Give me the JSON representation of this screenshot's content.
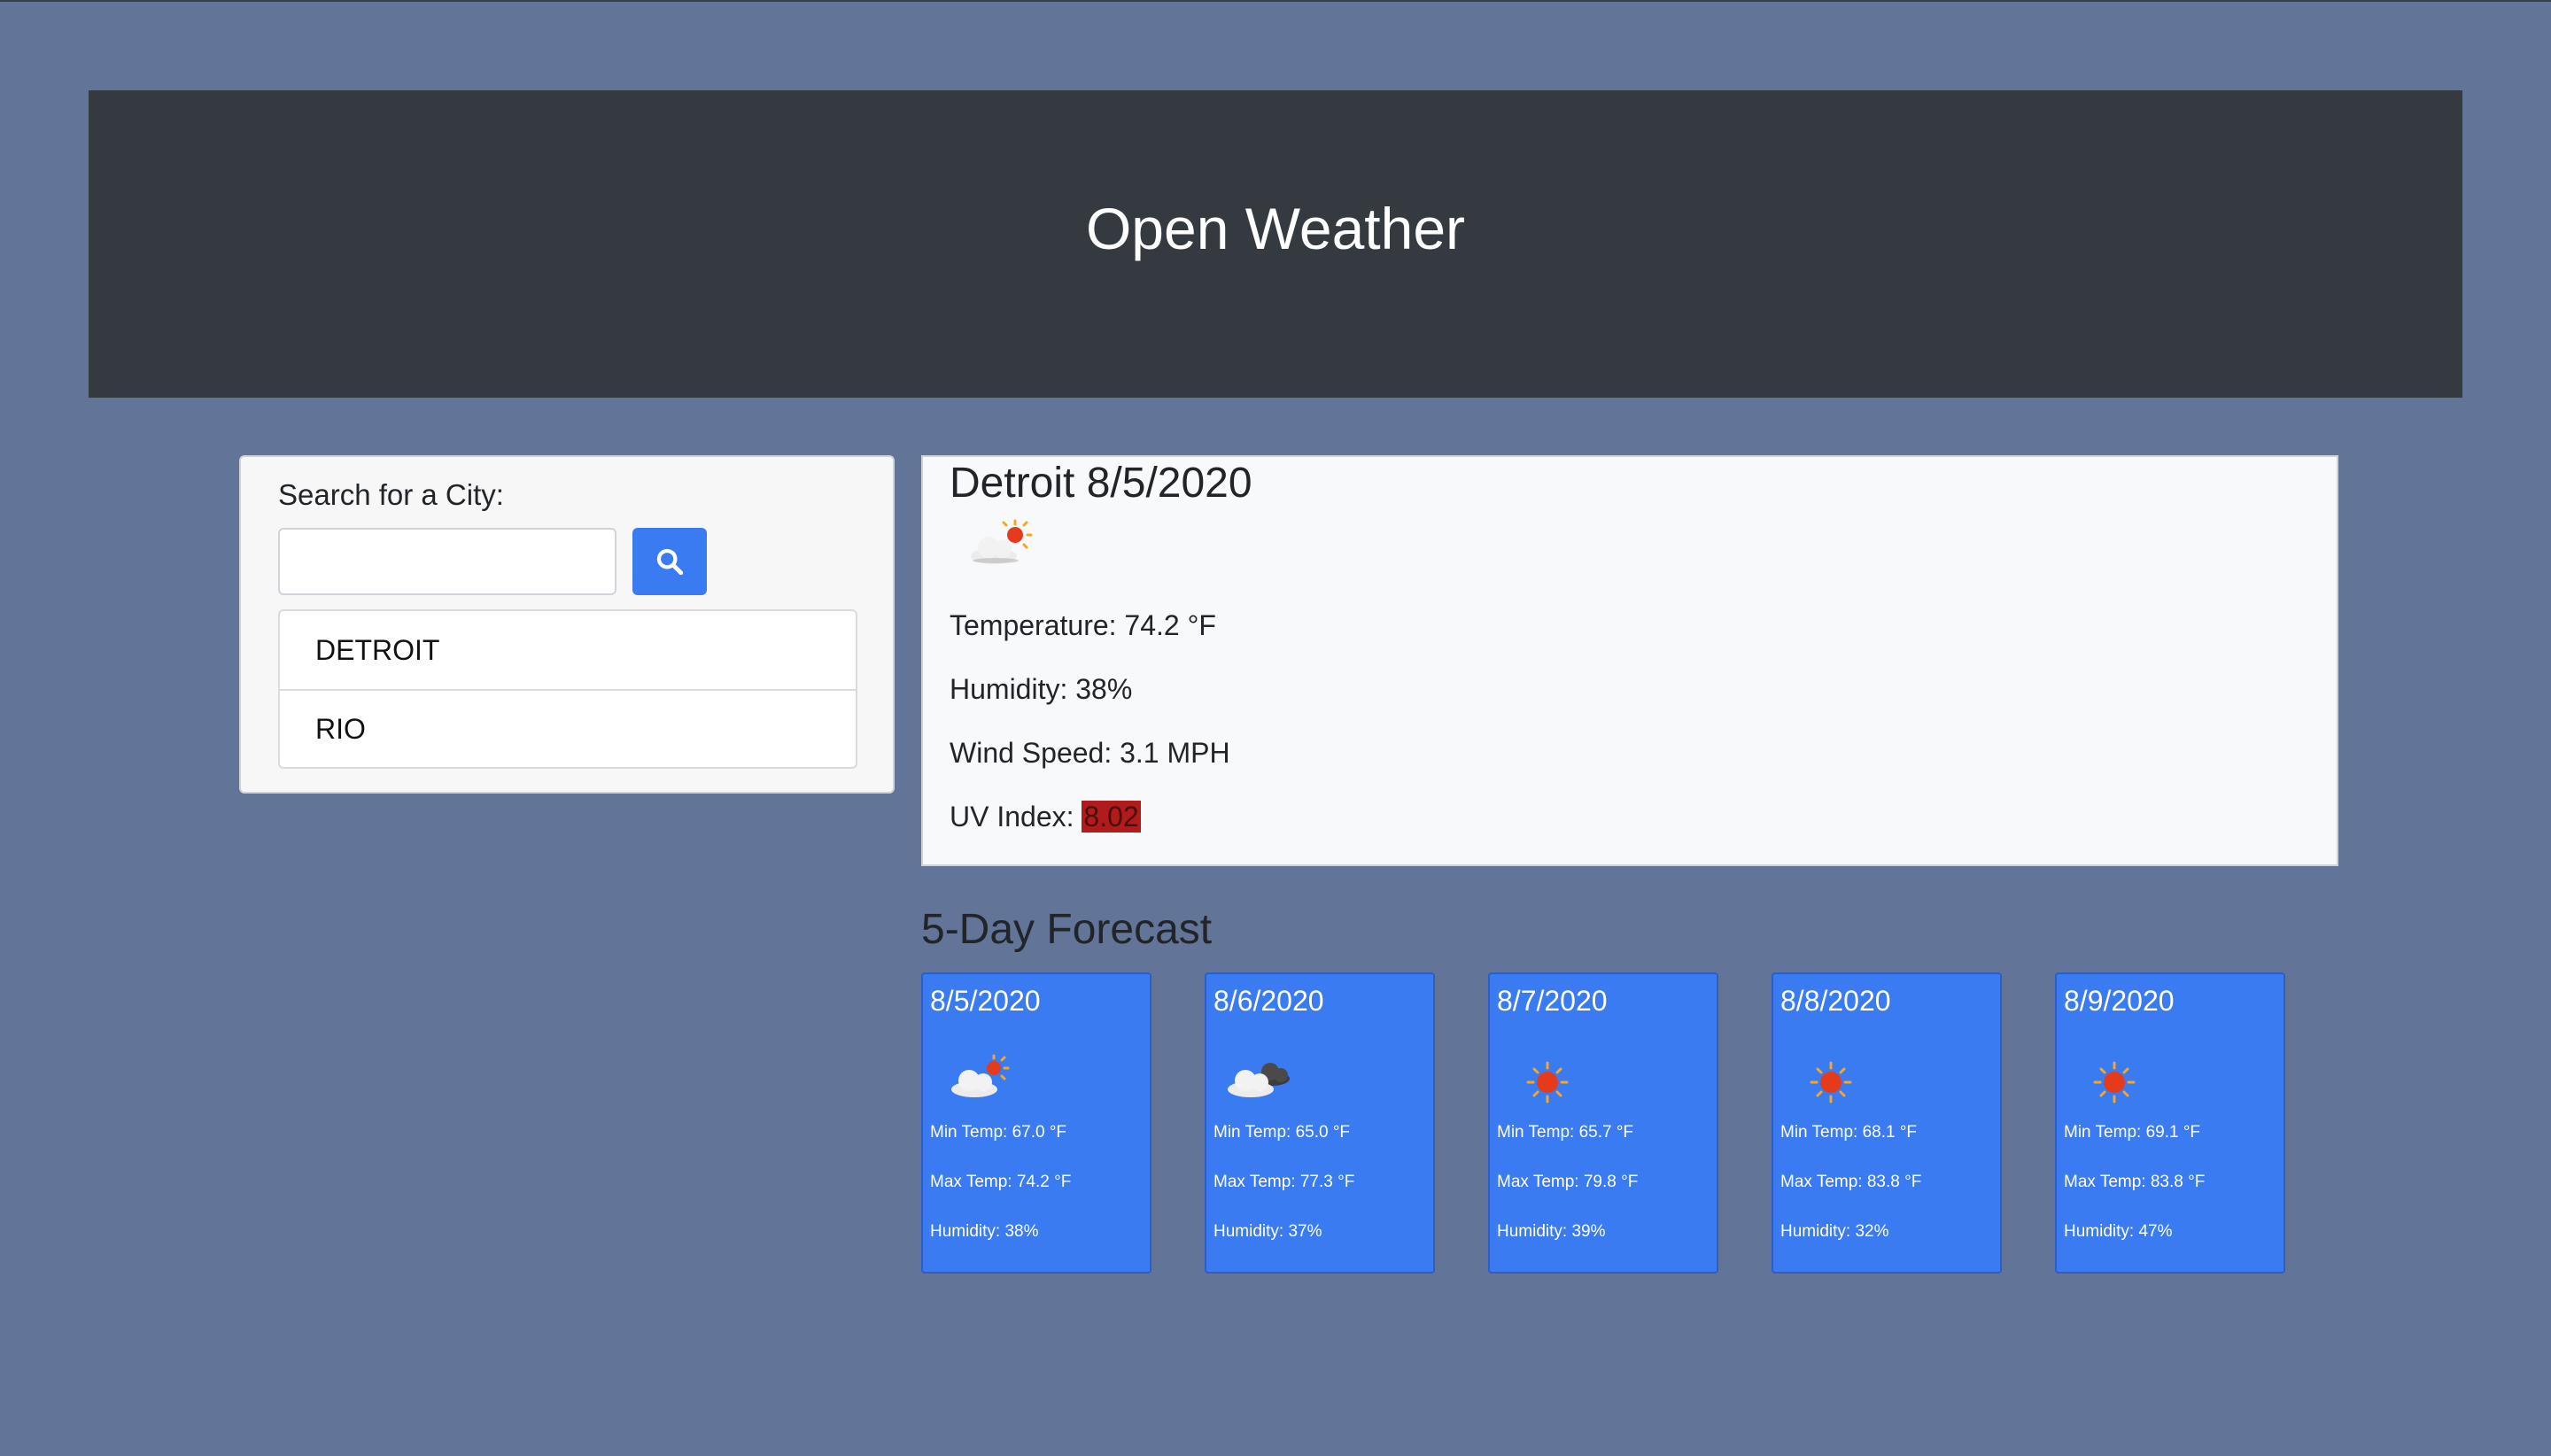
{
  "header": {
    "title": "Open Weather"
  },
  "search": {
    "label": "Search for a City:",
    "input_value": "",
    "placeholder": "",
    "button_icon": "search-icon",
    "history": [
      "DETROIT",
      "RIO"
    ]
  },
  "current": {
    "title": "Detroit 8/5/2020",
    "icon": "partly-cloudy-icon",
    "temperature": "Temperature: 74.2 °F",
    "humidity": "Humidity: 38%",
    "wind": "Wind Speed: 3.1 MPH",
    "uv_label": "UV Index: ",
    "uv_value": "8.02"
  },
  "forecast": {
    "title": "5-Day Forecast",
    "days": [
      {
        "date": "8/5/2020",
        "icon": "partly-cloudy-icon",
        "min": "Min Temp: 67.0 °F",
        "max": "Max Temp: 74.2 °F",
        "humidity": "Humidity: 38%"
      },
      {
        "date": "8/6/2020",
        "icon": "cloudy-icon",
        "min": "Min Temp: 65.0 °F",
        "max": "Max Temp: 77.3 °F",
        "humidity": "Humidity: 37%"
      },
      {
        "date": "8/7/2020",
        "icon": "sun-icon",
        "min": "Min Temp: 65.7 °F",
        "max": "Max Temp: 79.8 °F",
        "humidity": "Humidity: 39%"
      },
      {
        "date": "8/8/2020",
        "icon": "sun-icon",
        "min": "Min Temp: 68.1 °F",
        "max": "Max Temp: 83.8 °F",
        "humidity": "Humidity: 32%"
      },
      {
        "date": "8/9/2020",
        "icon": "sun-icon",
        "min": "Min Temp: 69.1 °F",
        "max": "Max Temp: 83.8 °F",
        "humidity": "Humidity: 47%"
      }
    ]
  },
  "colors": {
    "page_background": "#637499",
    "header_background": "#343a40",
    "accent": "#3a7bf2",
    "uv_severe": "#b11b1b"
  }
}
